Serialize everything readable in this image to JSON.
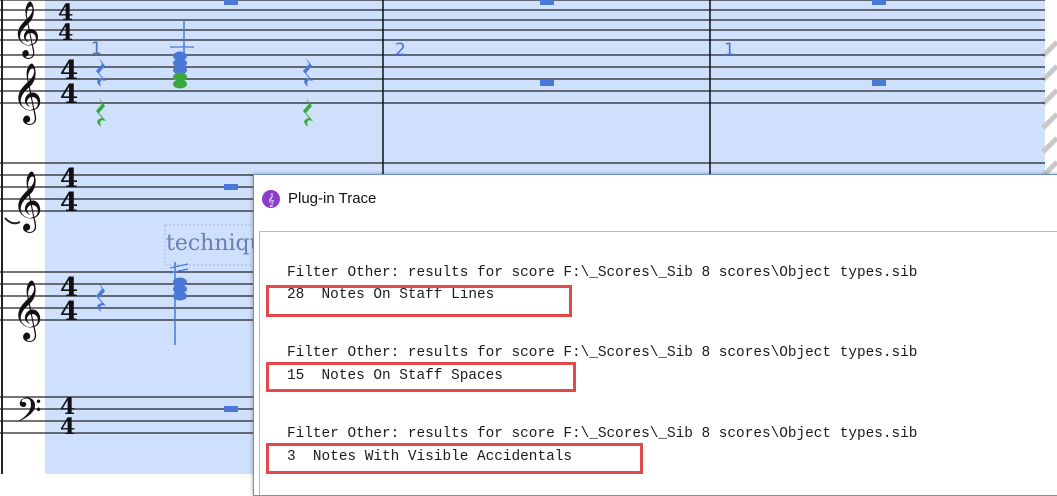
{
  "score": {
    "measure_numbers": [
      "1",
      "2",
      "1"
    ],
    "technique_text": "technique"
  },
  "trace_window": {
    "title": "Plug-in Trace",
    "app_icon": "sibelius-icon",
    "lines": [
      "Filter Other: results for score F:\\_Scores\\_Sib 8 scores\\Object types.sib",
      "28  Notes On Staff Lines",
      "Filter Other: results for score F:\\_Scores\\_Sib 8 scores\\Object types.sib",
      "15  Notes On Staff Spaces",
      "Filter Other: results for score F:\\_Scores\\_Sib 8 scores\\Object types.sib",
      "3  Notes With Visible Accidentals"
    ]
  },
  "colors": {
    "selection": "#cfe0fd",
    "selected_notes": "#4a78d6",
    "second_voice": "#39a83f",
    "highlight_box": "#e04a4a"
  }
}
